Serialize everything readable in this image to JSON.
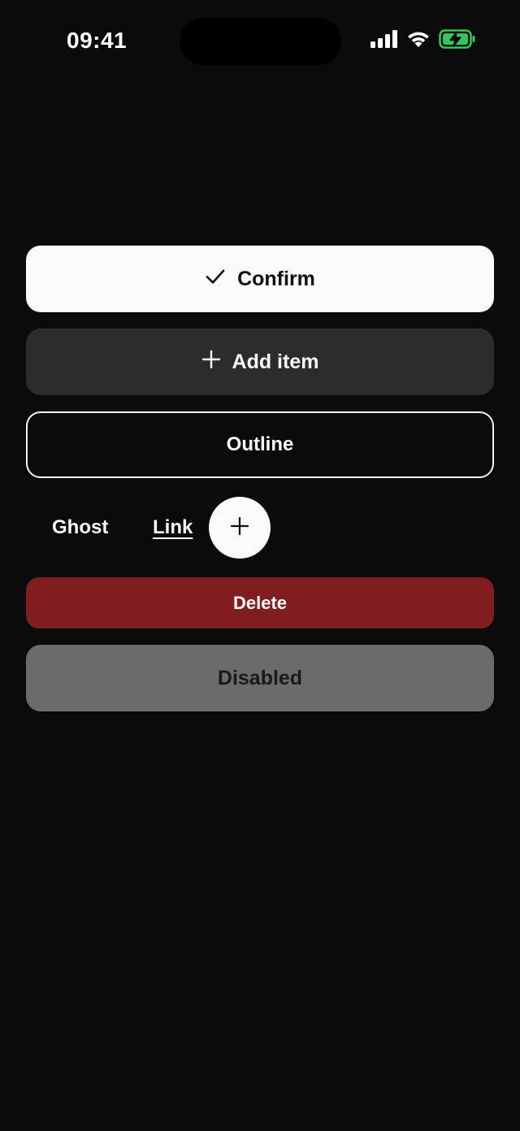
{
  "status_bar": {
    "time": "09:41",
    "icons": [
      "cellular-signal-icon",
      "wifi-icon",
      "battery-charging-icon"
    ],
    "battery_color": "#34c759"
  },
  "buttons": {
    "confirm": {
      "label": "Confirm",
      "icon": "check-icon"
    },
    "add_item": {
      "label": "Add item",
      "icon": "plus-icon"
    },
    "outline": {
      "label": "Outline"
    },
    "ghost": {
      "label": "Ghost"
    },
    "link": {
      "label": "Link"
    },
    "icon_button": {
      "icon": "plus-icon"
    },
    "delete": {
      "label": "Delete"
    },
    "disabled": {
      "label": "Disabled"
    }
  },
  "colors": {
    "background": "#0b0b0b",
    "primary": "#fafafa",
    "secondary": "#2c2c2c",
    "destructive": "#801d1e",
    "disabled": "#6b6b6b"
  }
}
